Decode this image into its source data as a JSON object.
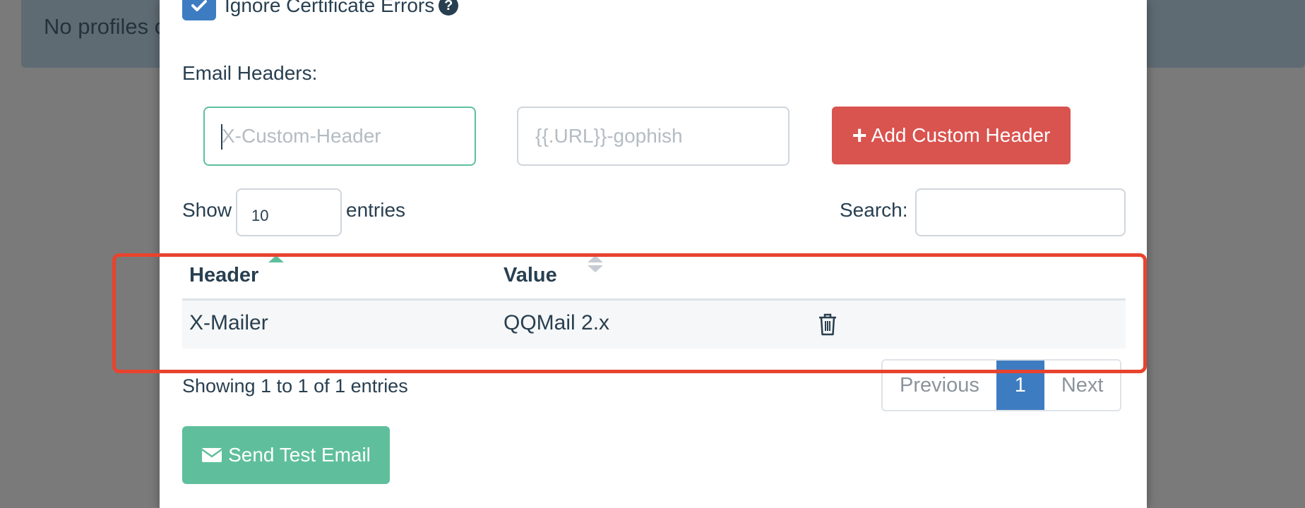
{
  "background": {
    "alert_text": "No profiles c"
  },
  "modal": {
    "ignore_cert": {
      "label": "Ignore Certificate Errors",
      "checked": true
    },
    "email_headers": {
      "label": "Email Headers:",
      "name_placeholder": "X-Custom-Header",
      "value_placeholder": "{{.URL}}-gophish",
      "add_button": "Add Custom Header"
    },
    "table_controls": {
      "show_label": "Show",
      "page_length": "10",
      "entries_label": "entries",
      "search_label": "Search:"
    },
    "table": {
      "columns": [
        "Header",
        "Value"
      ],
      "rows": [
        {
          "header": "X-Mailer",
          "value": "QQMail 2.x"
        }
      ]
    },
    "info": "Showing 1 to 1 of 1 entries",
    "pagination": {
      "previous": "Previous",
      "current": "1",
      "next": "Next"
    },
    "send_button": "Send Test Email"
  },
  "colors": {
    "accent_blue": "#3e7cc2",
    "danger": "#d9534f",
    "success": "#5fbf9c",
    "annotation": "#e8432e"
  },
  "icons": [
    "check-icon",
    "question-circle-icon",
    "plus-icon",
    "trash-icon",
    "envelope-icon"
  ]
}
